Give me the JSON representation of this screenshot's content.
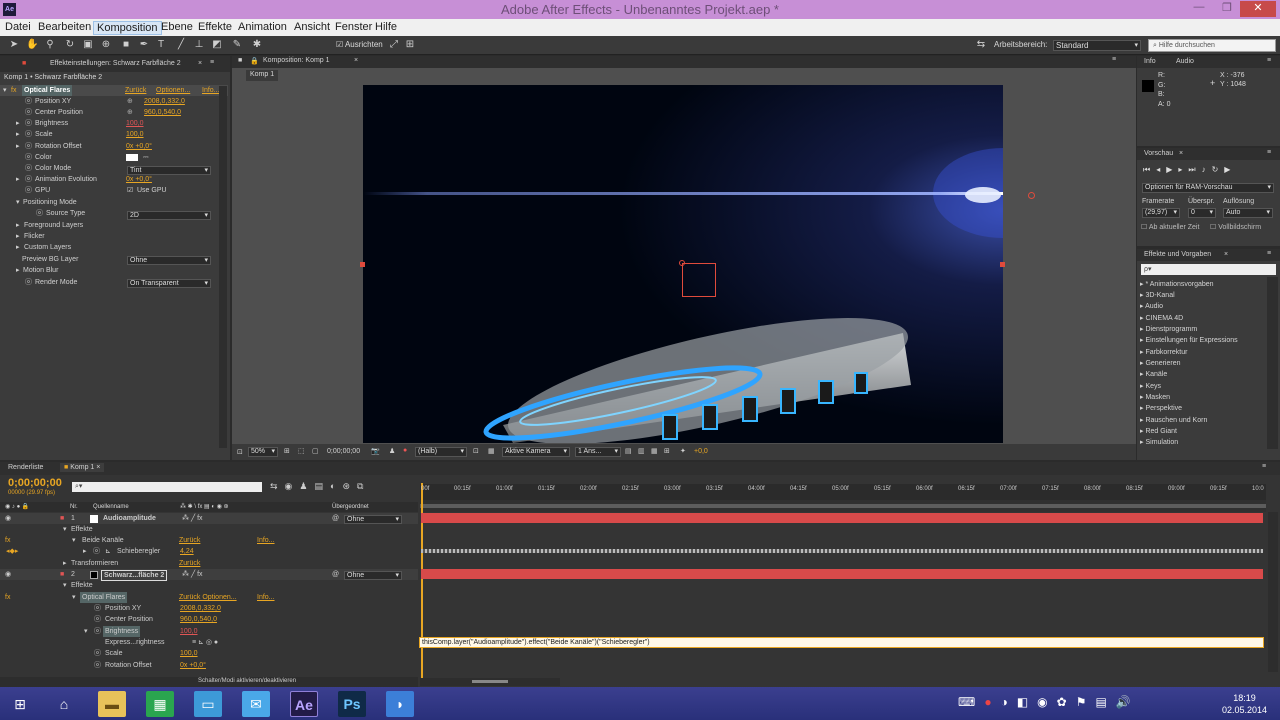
{
  "window": {
    "title": "Adobe After Effects - Unbenanntes Projekt.aep *",
    "app_badge": "Ae",
    "btn_min": "—",
    "btn_max": "❐",
    "btn_close": "✕"
  },
  "menu": [
    "Datei",
    "Bearbeiten",
    "Komposition",
    "Ebene",
    "Effekte",
    "Animation",
    "Ansicht",
    "Fenster",
    "Hilfe"
  ],
  "toolbar": {
    "align_label": "Ausrichten",
    "workspace_label": "Arbeitsbereich:",
    "workspace_value": "Standard",
    "help_placeholder": "Hilfe durchsuchen"
  },
  "effect_panel": {
    "tab": "Effekteinstellungen: Schwarz Farbfläche 2",
    "breadcrumb": "Komp 1 • Schwarz Farbfläche 2",
    "effect_name": "Optical Flares",
    "reset": "Zurück",
    "options": "Optionen...",
    "info": "Info...",
    "props": [
      {
        "label": "Position XY",
        "value": "2008,0,332,0"
      },
      {
        "label": "Center Position",
        "value": "960,0,540,0"
      },
      {
        "label": "Brightness",
        "value": "100,0"
      },
      {
        "label": "Scale",
        "value": "100,0"
      },
      {
        "label": "Rotation Offset",
        "value": "0x +0,0°"
      },
      {
        "label": "Color",
        "value": ""
      },
      {
        "label": "Color Mode",
        "value": "Tint"
      },
      {
        "label": "Animation Evolution",
        "value": "0x +0,0°"
      },
      {
        "label": "GPU",
        "value": "Use GPU"
      },
      {
        "label": "Positioning Mode",
        "value": ""
      },
      {
        "label": "Source Type",
        "value": "2D"
      },
      {
        "label": "Foreground Layers",
        "value": ""
      },
      {
        "label": "Flicker",
        "value": ""
      },
      {
        "label": "Custom Layers",
        "value": ""
      },
      {
        "label": "Preview BG Layer",
        "value": "Ohne"
      },
      {
        "label": "Motion Blur",
        "value": ""
      },
      {
        "label": "Render Mode",
        "value": "On Transparent"
      }
    ]
  },
  "comp_panel": {
    "tab": "Komposition: Komp 1",
    "subtab": "Komp 1",
    "zoom": "50%",
    "timecode": "0;00;00;00",
    "resolution": "(Halb)",
    "camera": "Aktive Kamera",
    "views": "1 Ans...",
    "exposure": "+0,0"
  },
  "info_panel": {
    "tab_info": "Info",
    "tab_audio": "Audio",
    "r": "R:",
    "g": "G:",
    "b": "B:",
    "a": "A:",
    "a_value": "0",
    "x": "X : -376",
    "y": "Y : 1048"
  },
  "preview_panel": {
    "tab": "Vorschau",
    "ram_options": "Optionen für RAM-Vorschau",
    "framerate_label": "Framerate",
    "skip_label": "Überspr.",
    "resolution_label": "Auflösung",
    "framerate_value": "(29,97)",
    "skip_value": "0",
    "resolution_value": "Auto",
    "from_current": "Ab aktueller Zeit",
    "fullscreen": "Vollbildschirm"
  },
  "effects_presets": {
    "tab": "Effekte und Vorgaben",
    "search": "ρ▾",
    "items": [
      "* Animationsvorgaben",
      "3D-Kanal",
      "Audio",
      "CINEMA 4D",
      "Dienstprogramm",
      "Einstellungen für Expressions",
      "Farbkorrektur",
      "Generieren",
      "Kanäle",
      "Keys",
      "Masken",
      "Perspektive",
      "Rauschen und Korn",
      "Red Giant",
      "Simulation"
    ]
  },
  "timeline": {
    "tab_render": "Renderliste",
    "tab_comp": "Komp 1",
    "timecode": "0;00;00;00",
    "fps": "00000 (29.97 fps)",
    "col_nr": "Nr.",
    "col_source": "Quellenname",
    "col_parent": "Übergeordnet",
    "ruler": [
      "00f",
      "00:15f",
      "01:00f",
      "01:15f",
      "02:00f",
      "02:15f",
      "03:00f",
      "03:15f",
      "04:00f",
      "04:15f",
      "05:00f",
      "05:15f",
      "06:00f",
      "06:15f",
      "07:00f",
      "07:15f",
      "08:00f",
      "08:15f",
      "09:00f",
      "09:15f",
      "10:0"
    ],
    "rows": [
      {
        "indent": 0,
        "num": "1",
        "label": "Audioamplitude",
        "value": "Ohne"
      },
      {
        "indent": 1,
        "label": "Effekte"
      },
      {
        "indent": 2,
        "label": "Beide Kanäle",
        "value": "Zurück",
        "info": "Info..."
      },
      {
        "indent": 3,
        "label": "Schieberegler",
        "value": "4,24"
      },
      {
        "indent": 1,
        "label": "Transformieren",
        "value": "Zurück"
      },
      {
        "indent": 0,
        "num": "2",
        "label": "Schwarz...fläche 2",
        "value": "Ohne"
      },
      {
        "indent": 1,
        "label": "Effekte"
      },
      {
        "indent": 2,
        "label": "Optical Flares",
        "value": "Zurück  Optionen...",
        "info": "Info..."
      },
      {
        "indent": 3,
        "label": "Position XY",
        "value": "2008,0,332,0"
      },
      {
        "indent": 3,
        "label": "Center Position",
        "value": "960,0,540,0"
      },
      {
        "indent": 3,
        "label": "Brightness",
        "value": "100,0"
      },
      {
        "indent": 4,
        "label": "Express...rightness"
      },
      {
        "indent": 3,
        "label": "Scale",
        "value": "100,0"
      },
      {
        "indent": 3,
        "label": "Rotation Offset",
        "value": "0x +0,0°"
      }
    ],
    "expression": "thisComp.layer(\"Audioamplitude\").effect(\"Beide Kanäle\")(\"Schieberegler\")",
    "footer": "Schalter/Modi aktivieren/deaktivieren"
  },
  "taskbar": {
    "time": "18:19",
    "date": "02.05.2014",
    "ae": "Ae",
    "ps": "Ps"
  }
}
